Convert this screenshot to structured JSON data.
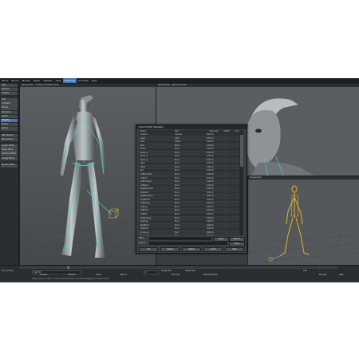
{
  "menubar": {
    "items": [
      "Items",
      "Bones",
      "Modify",
      "Setup",
      "Utilities",
      "View",
      "Windows",
      "Animate",
      "Help"
    ],
    "active_index": 6
  },
  "sidebar": {
    "groups": [
      [
        "Add",
        "Actions",
        "Display"
      ],
      [
        "Add",
        "Animate",
        "Bones",
        "Cameras",
        "Lights",
        "Objects",
        "Scene",
        "Spline"
      ],
      [
        "Item Props",
        "Bone Props"
      ],
      [
        "Graph Editor",
        "Dope Track",
        "Surface Editor",
        "Image Editor"
      ],
      [
        "Motion Mixer"
      ]
    ],
    "highlight": "Objects"
  },
  "viewports": {
    "main_label": "Perspective",
    "main_mode": "Textured Shaded Solid",
    "top_label": "Perspective",
    "top_mode": "Textured Solid",
    "bottom_label": "Perspective"
  },
  "dialog": {
    "title": "Scene Editor Manager",
    "columns": [
      "Name",
      "Item",
      "Channels",
      "Visible",
      "Lock"
    ],
    "rows": [
      [
        "Camera",
        "Camera",
        "100.0%"
      ],
      [
        "Light",
        "Light",
        "100.0%"
      ],
      [
        "Alien",
        "Object",
        "100.0%"
      ],
      [
        "Root",
        "Bone",
        "100.0%"
      ],
      [
        "Pelvis",
        "Bone",
        "100.0%"
      ],
      [
        "Spine_1",
        "Bone",
        "100.0%"
      ],
      [
        "Spine_2",
        "Bone",
        "100.0%"
      ],
      [
        "Spine_3",
        "Bone",
        "100.0%"
      ],
      [
        "Neck",
        "Bone",
        "100.0%"
      ],
      [
        "Head",
        "Bone",
        "100.0%"
      ],
      [
        "Jaw",
        "Bone",
        "100.0%"
      ],
      [
        "LeftShoulder",
        "Bone",
        "100.0%"
      ],
      [
        "LeftArm",
        "Bone",
        "100.0%"
      ],
      [
        "LeftForeArm",
        "Bone",
        "100.0%"
      ],
      [
        "LeftHand",
        "Bone",
        "100.0%"
      ],
      [
        "RightShoulder",
        "Bone",
        "100.0%"
      ],
      [
        "RightArm",
        "Bone",
        "100.0%"
      ],
      [
        "RightForeArm",
        "Bone",
        "100.0%"
      ],
      [
        "RightHand",
        "Bone",
        "100.0%"
      ],
      [
        "LeftUpLeg",
        "Bone",
        "100.0%"
      ],
      [
        "LeftLeg",
        "Bone",
        "100.0%"
      ],
      [
        "LeftFoot",
        "Bone",
        "100.0%"
      ],
      [
        "LeftToe",
        "Bone",
        "100.0%"
      ],
      [
        "RightUpLeg",
        "Bone",
        "100.0%"
      ],
      [
        "RightLeg",
        "Bone",
        "100.0%"
      ],
      [
        "RightFoot",
        "Bone",
        "100.0%"
      ],
      [
        "RightToe",
        "Bone",
        "100.0%"
      ],
      [
        "IK_Goal_L",
        "Null",
        "100.0%"
      ],
      [
        "IK_Goal_R",
        "Null",
        "100.0%"
      ],
      [
        "Pole_L",
        "Null",
        "100.0%"
      ],
      [
        "Pole_R",
        "Null",
        "100.0%"
      ],
      [
        "Target",
        "Null",
        "100.0%"
      ],
      [
        "Ground",
        "Object",
        "100.0%"
      ],
      [
        "Backdrop",
        "Object",
        "100.0%"
      ],
      [
        "Rig_Ctrl",
        "Null",
        "100.0%"
      ],
      [
        "Cam_Target",
        "Null",
        "100.0%"
      ]
    ],
    "footer": {
      "filter_label": "Filter",
      "apply_label": "Apply",
      "refresh_label": "Refresh",
      "search_label": "Search",
      "clear_label": "Clear",
      "buttons": [
        "All",
        "Select",
        "Visible",
        "Invert",
        "Hide"
      ]
    }
  },
  "timeline": {
    "current_item_label": "Current Item",
    "current_item": "Light 01",
    "frame_field": "0",
    "position": "Position",
    "rotation": "Rotation",
    "scale": "Scale",
    "create_key": "Create Key",
    "delete_key": "Delete Key",
    "options": "Options",
    "preview": "Preview",
    "step": "Step",
    "frame_end": "120",
    "status": "Drag mouse in view to move selected items. ALT while dragging to snap to items.",
    "auto_key": "Auto Key",
    "selected_items": "Selected Items"
  },
  "colors": {
    "accent": "#3f78b8",
    "skeleton": "#e8b020",
    "rig_lines": "#4ad0d0"
  }
}
